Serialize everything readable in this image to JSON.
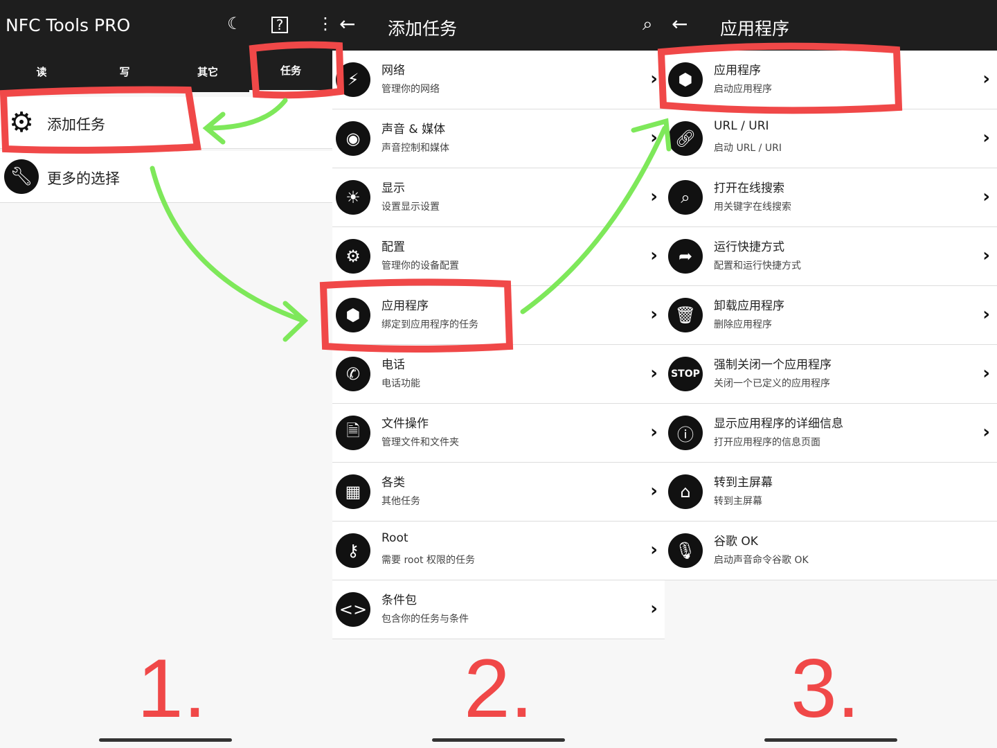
{
  "panel1": {
    "title": "NFC Tools PRO",
    "icons": [
      "nfc-icon",
      "help-icon",
      "more-icon"
    ],
    "tabs": [
      "读",
      "写",
      "其它",
      "任务"
    ],
    "active_tab": "任务",
    "items": [
      {
        "label": "添加任务",
        "icon": "gear-add-icon"
      },
      {
        "label": "更多的选择",
        "icon": "wrench-icon"
      }
    ],
    "step": "1."
  },
  "panel2": {
    "title": "添加任务",
    "step": "2.",
    "items": [
      {
        "title": "网络",
        "subtitle": "管理你的网络",
        "icon": "lightning-icon"
      },
      {
        "title": "声音 & 媒体",
        "subtitle": "声音控制和媒体",
        "icon": "volume-knob-icon"
      },
      {
        "title": "显示",
        "subtitle": "设置显示设置",
        "icon": "sun-icon"
      },
      {
        "title": "配置",
        "subtitle": "管理你的设备配置",
        "icon": "gear-icon"
      },
      {
        "title": "应用程序",
        "subtitle": "绑定到应用程序的任务",
        "icon": "box-icon"
      },
      {
        "title": "电话",
        "subtitle": "电话功能",
        "icon": "phone-icon"
      },
      {
        "title": "文件操作",
        "subtitle": "管理文件和文件夹",
        "icon": "file-gear-icon"
      },
      {
        "title": "各类",
        "subtitle": "其他任务",
        "icon": "blocks-icon"
      },
      {
        "title": "Root",
        "subtitle": "需要 root 权限的任务",
        "icon": "key-icon"
      },
      {
        "title": "条件包",
        "subtitle": "包含你的任务与条件",
        "icon": "code-icon"
      }
    ]
  },
  "panel3": {
    "title": "应用程序",
    "step": "3.",
    "items": [
      {
        "title": "应用程序",
        "subtitle": "启动应用程序",
        "icon": "cube-icon"
      },
      {
        "title": "URL / URI",
        "subtitle": "启动 URL / URI",
        "icon": "link-icon"
      },
      {
        "title": "打开在线搜索",
        "subtitle": "用关键字在线搜索",
        "icon": "search-icon"
      },
      {
        "title": "运行快捷方式",
        "subtitle": "配置和运行快捷方式",
        "icon": "shortcut-arrow-icon"
      },
      {
        "title": "卸载应用程序",
        "subtitle": "删除应用程序",
        "icon": "trash-icon"
      },
      {
        "title": "强制关闭一个应用程序",
        "subtitle": "关闭一个已定义的应用程序",
        "icon": "stop-icon"
      },
      {
        "title": "显示应用程序的详细信息",
        "subtitle": "打开应用程序的信息页面",
        "icon": "info-icon"
      },
      {
        "title": "转到主屏幕",
        "subtitle": "转到主屏幕",
        "icon": "home-icon"
      },
      {
        "title": "谷歌 OK",
        "subtitle": "启动声音命令谷歌 OK",
        "icon": "microphone-icon"
      }
    ]
  },
  "colors": {
    "bar": "#1e1e1e",
    "annotation_red": "#f04848",
    "annotation_green": "#7ee85a"
  }
}
